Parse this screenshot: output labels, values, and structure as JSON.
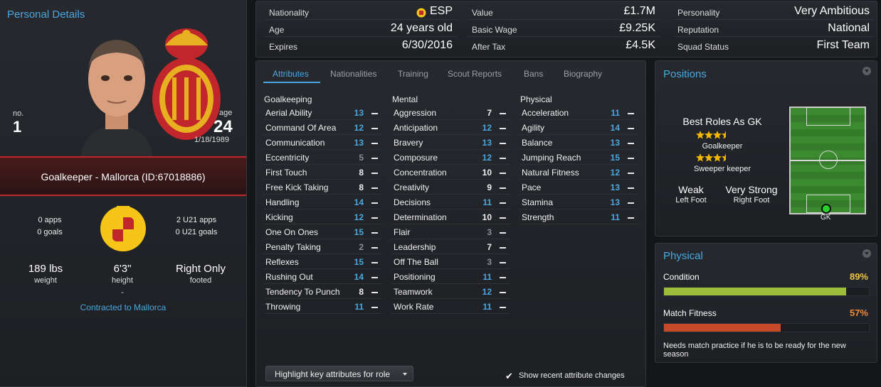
{
  "left": {
    "title": "Personal Details",
    "no_label": "no.",
    "number": "1",
    "age_label": "age",
    "age": "24",
    "dob": "1/18/1989",
    "position_club": "Goalkeeper - Mallorca (ID:67018886)",
    "apps": "0 apps",
    "goals": "0 goals",
    "u21_apps": "2 U21 apps",
    "u21_goals": "0 U21 goals",
    "weight": "189 lbs",
    "weight_label": "weight",
    "height": "6'3\"",
    "height_label": "height",
    "foot": "Right Only",
    "foot_label": "footed",
    "dash": "-",
    "contract_link": "Contracted to Mallorca"
  },
  "info": {
    "nationality_label": "Nationality",
    "nationality": "ESP",
    "age_label": "Age",
    "age": "24 years old",
    "expires_label": "Expires",
    "expires": "6/30/2016",
    "value_label": "Value",
    "value": "£1.7M",
    "wage_label": "Basic Wage",
    "wage": "£9.25K",
    "aftertax_label": "After Tax",
    "aftertax": "£4.5K",
    "personality_label": "Personality",
    "personality": "Very Ambitious",
    "reputation_label": "Reputation",
    "reputation": "National",
    "squad_label": "Squad Status",
    "squad": "First Team"
  },
  "tabs": [
    "Attributes",
    "Nationalities",
    "Training",
    "Scout Reports",
    "Bans",
    "Biography"
  ],
  "attributes": {
    "goalkeeping_label": "Goalkeeping",
    "mental_label": "Mental",
    "physical_label": "Physical",
    "goalkeeping": [
      {
        "name": "Aerial Ability",
        "value": "13",
        "tone": "blue"
      },
      {
        "name": "Command Of Area",
        "value": "12",
        "tone": "blue"
      },
      {
        "name": "Communication",
        "value": "13",
        "tone": "blue"
      },
      {
        "name": "Eccentricity",
        "value": "5",
        "tone": "grey"
      },
      {
        "name": "First Touch",
        "value": "8",
        "tone": "white"
      },
      {
        "name": "Free Kick Taking",
        "value": "8",
        "tone": "white"
      },
      {
        "name": "Handling",
        "value": "14",
        "tone": "blue"
      },
      {
        "name": "Kicking",
        "value": "12",
        "tone": "blue"
      },
      {
        "name": "One On Ones",
        "value": "15",
        "tone": "blue"
      },
      {
        "name": "Penalty Taking",
        "value": "2",
        "tone": "grey"
      },
      {
        "name": "Reflexes",
        "value": "15",
        "tone": "blue"
      },
      {
        "name": "Rushing Out",
        "value": "14",
        "tone": "blue"
      },
      {
        "name": "Tendency To Punch",
        "value": "8",
        "tone": "white"
      },
      {
        "name": "Throwing",
        "value": "11",
        "tone": "blue"
      }
    ],
    "mental": [
      {
        "name": "Aggression",
        "value": "7",
        "tone": "white"
      },
      {
        "name": "Anticipation",
        "value": "12",
        "tone": "blue"
      },
      {
        "name": "Bravery",
        "value": "13",
        "tone": "blue"
      },
      {
        "name": "Composure",
        "value": "12",
        "tone": "blue"
      },
      {
        "name": "Concentration",
        "value": "10",
        "tone": "white"
      },
      {
        "name": "Creativity",
        "value": "9",
        "tone": "white"
      },
      {
        "name": "Decisions",
        "value": "11",
        "tone": "blue"
      },
      {
        "name": "Determination",
        "value": "10",
        "tone": "white"
      },
      {
        "name": "Flair",
        "value": "3",
        "tone": "grey"
      },
      {
        "name": "Leadership",
        "value": "7",
        "tone": "white"
      },
      {
        "name": "Off The Ball",
        "value": "3",
        "tone": "grey"
      },
      {
        "name": "Positioning",
        "value": "11",
        "tone": "blue"
      },
      {
        "name": "Teamwork",
        "value": "12",
        "tone": "blue"
      },
      {
        "name": "Work Rate",
        "value": "11",
        "tone": "blue"
      }
    ],
    "physical": [
      {
        "name": "Acceleration",
        "value": "11",
        "tone": "blue"
      },
      {
        "name": "Agility",
        "value": "14",
        "tone": "blue"
      },
      {
        "name": "Balance",
        "value": "13",
        "tone": "blue"
      },
      {
        "name": "Jumping Reach",
        "value": "15",
        "tone": "blue"
      },
      {
        "name": "Natural Fitness",
        "value": "12",
        "tone": "blue"
      },
      {
        "name": "Pace",
        "value": "13",
        "tone": "blue"
      },
      {
        "name": "Stamina",
        "value": "13",
        "tone": "blue"
      },
      {
        "name": "Strength",
        "value": "11",
        "tone": "blue"
      }
    ],
    "highlight_button": "Highlight key attributes for role",
    "show_changes": "Show recent attribute changes"
  },
  "positions": {
    "title": "Positions",
    "best_roles": "Best Roles As GK",
    "roles": [
      {
        "name": "Goalkeeper",
        "stars": 3.5
      },
      {
        "name": "Sweeper keeper",
        "stars": 3.5
      }
    ],
    "weak": "Weak",
    "weak_foot": "Left Foot",
    "strong": "Very Strong",
    "strong_foot": "Right Foot",
    "pitch_position": "GK"
  },
  "physical": {
    "title": "Physical",
    "condition_label": "Condition",
    "condition": "89%",
    "condition_fraction": 0.89,
    "fitness_label": "Match Fitness",
    "fitness": "57%",
    "fitness_fraction": 0.57,
    "note": "Needs match practice if he is to be ready for the new season"
  },
  "colors": {
    "accent": "#4aa8e0",
    "condition_bar": "#9bbd3a",
    "fitness_bar": "#c54a2a",
    "condition_text": "#f2c744",
    "fitness_text": "#ef8a3a",
    "club_red": "#c0262b"
  }
}
